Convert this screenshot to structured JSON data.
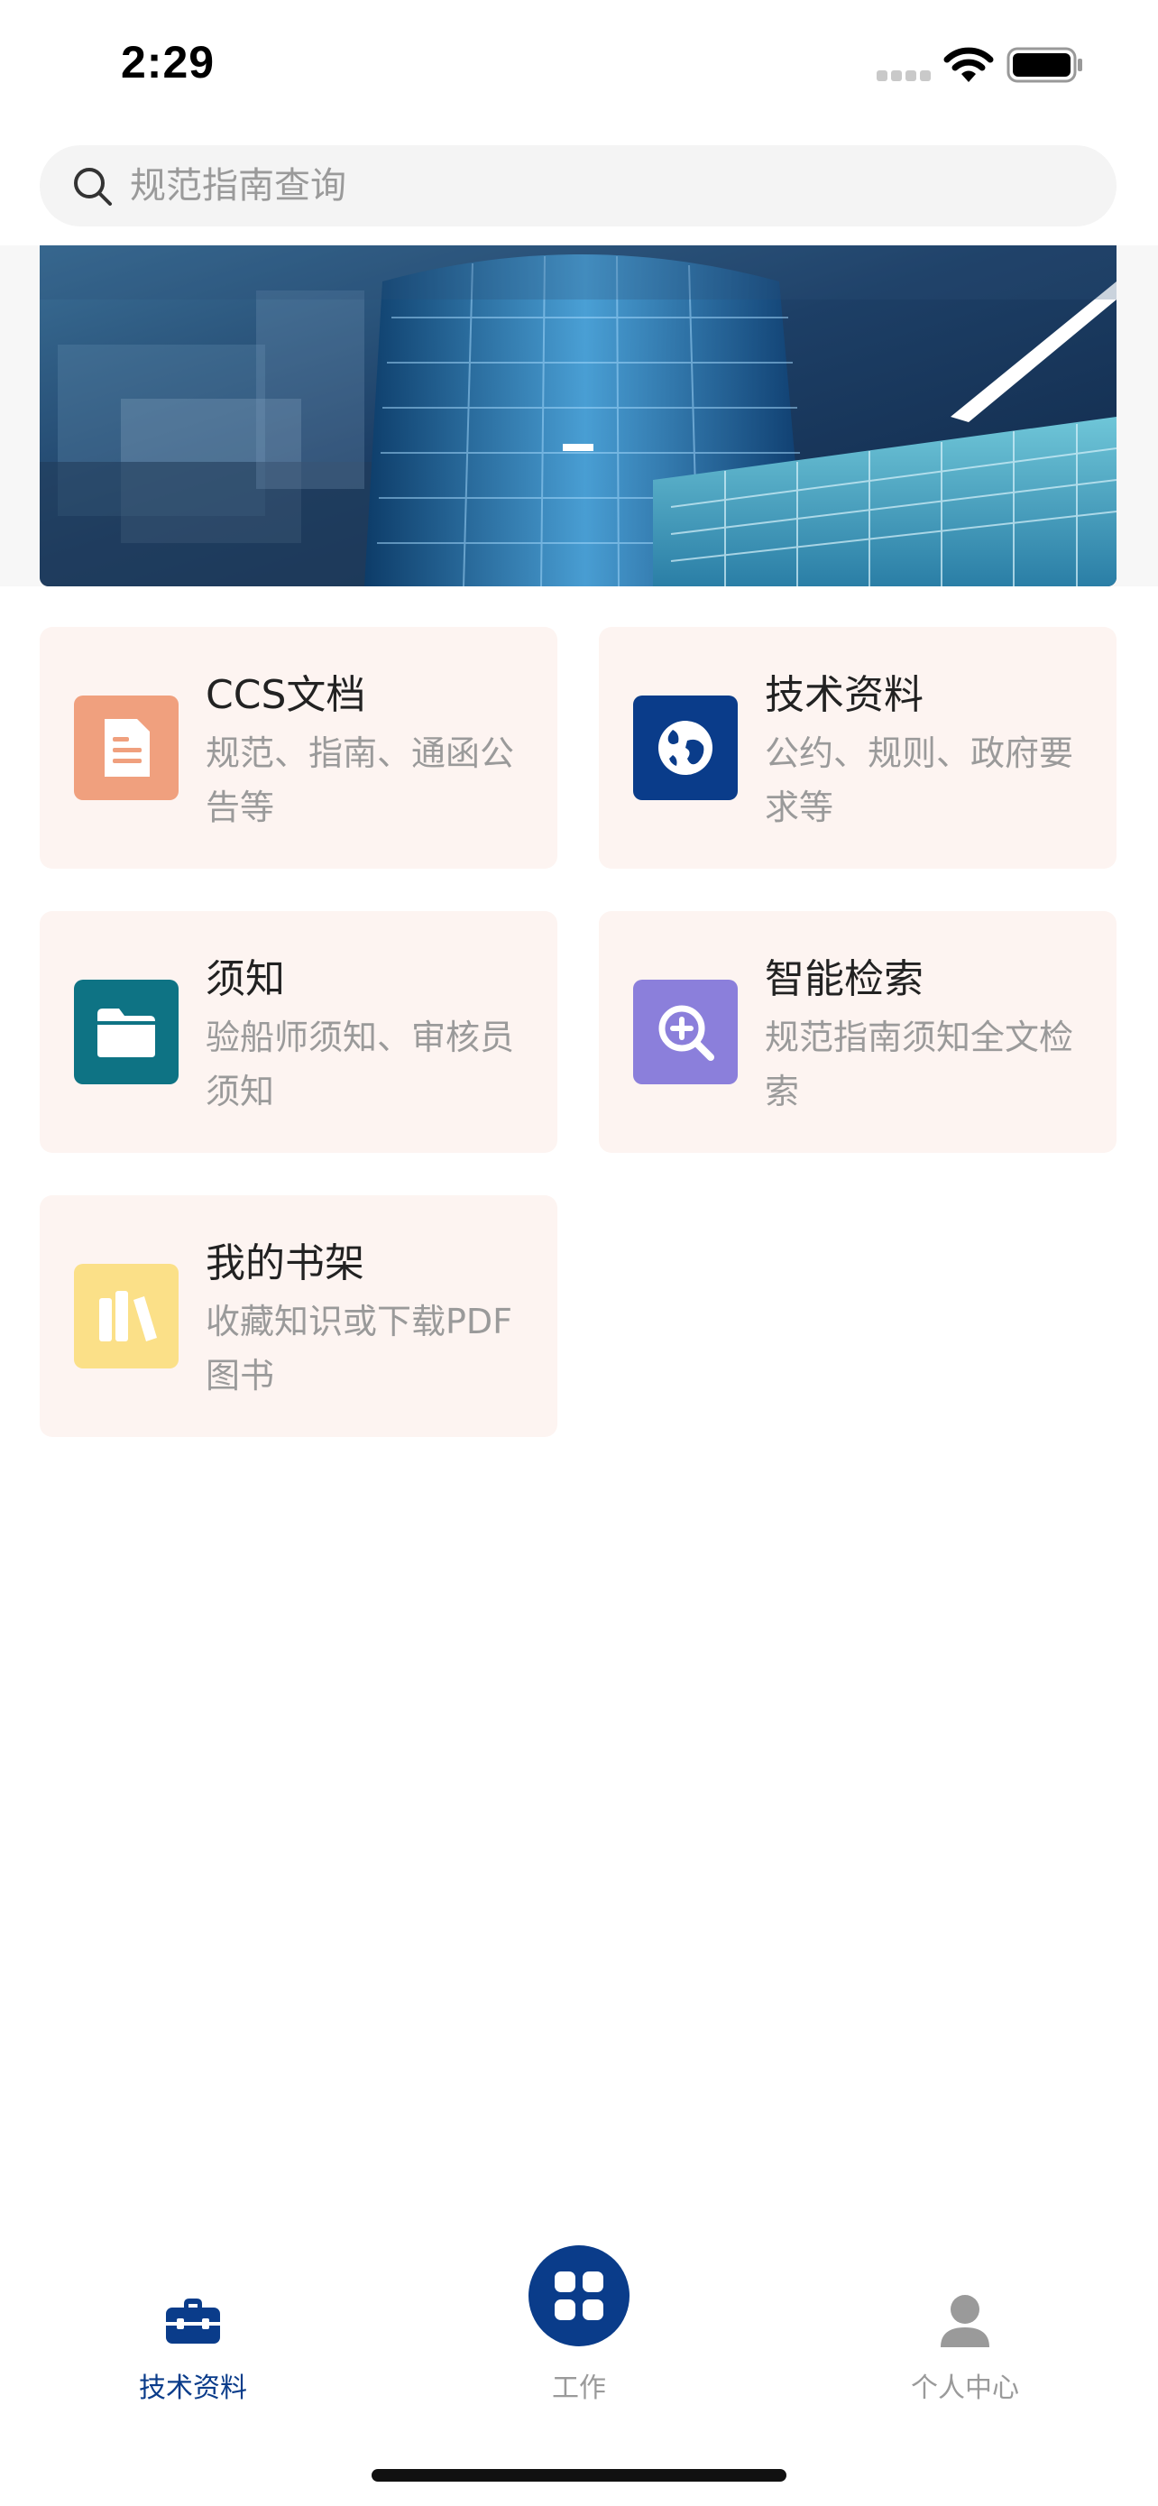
{
  "status_bar": {
    "time": "2:29"
  },
  "search": {
    "placeholder": "规范指南查询"
  },
  "cards": [
    {
      "title": "CCS文档",
      "desc": "规范、指南、通函公告等",
      "icon": "document-icon",
      "icon_color": "#f0a07e"
    },
    {
      "title": "技术资料",
      "desc": "公约、规则、政府要求等",
      "icon": "globe-icon",
      "icon_color": "#0a3c8a"
    },
    {
      "title": "须知",
      "desc": "验船师须知、审核员须知",
      "icon": "folder-icon",
      "icon_color": "#0e7384"
    },
    {
      "title": "智能检索",
      "desc": "规范指南须知全文检索",
      "icon": "zoom-in-icon",
      "icon_color": "#8b7fdb"
    },
    {
      "title": "我的书架",
      "desc": "收藏知识或下载PDF图书",
      "icon": "books-icon",
      "icon_color": "#fbe088"
    }
  ],
  "tabbar": {
    "items": [
      {
        "label": "技术资料",
        "icon": "briefcase-icon",
        "active": true
      },
      {
        "label": "工作",
        "icon": "grid-icon",
        "active": false
      },
      {
        "label": "个人中心",
        "icon": "person-icon",
        "active": false
      }
    ]
  },
  "colors": {
    "accent": "#0a3c8a",
    "card_bg": "#fdf4f1",
    "inactive": "#9a9a9a"
  }
}
